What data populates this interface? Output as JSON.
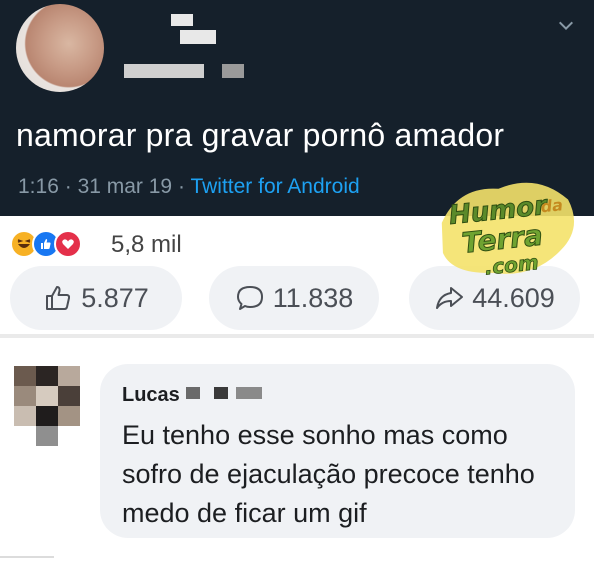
{
  "tweet": {
    "text": "namorar pra gravar pornô amador",
    "time": "1:16",
    "date": "31 mar 19",
    "separator": "·",
    "source": "Twitter for Android",
    "menu_icon": "chevron-down-icon"
  },
  "watermark": {
    "line1": "Humor",
    "line2": "da",
    "line3": "Terra",
    "line4": ".com"
  },
  "post": {
    "reactions": [
      "haha-icon",
      "like-icon",
      "love-icon"
    ],
    "reaction_count": "5,8 mil",
    "like_count": "5.877",
    "comment_count": "11.838",
    "share_count": "44.609"
  },
  "comment": {
    "author": "Lucas",
    "text": "Eu tenho esse sonho mas como sofro de ejaculação precoce tenho medo de ficar um gif"
  },
  "colors": {
    "tweet_bg": "#15202b",
    "twitter_blue": "#1da1f2",
    "facebook_blue": "#1877f2",
    "bubble_bg": "#f0f2f5"
  }
}
